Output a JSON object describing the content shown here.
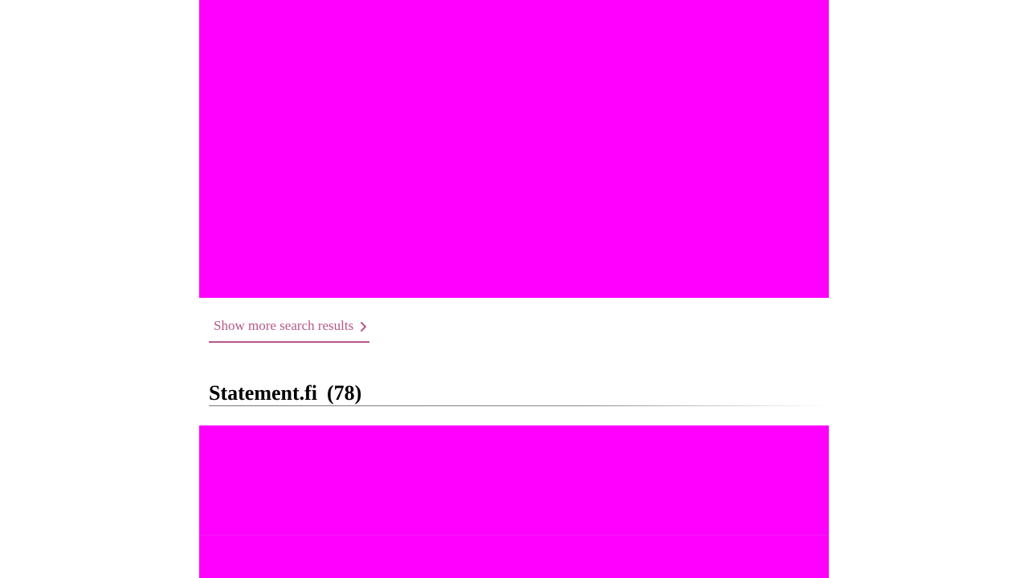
{
  "results": {
    "show_more_label": "Show more search results",
    "show_more_icon": "chevron-right-icon",
    "accent_color": "#b5588a"
  },
  "section": {
    "title": "Statement.fi",
    "count": "(78)"
  },
  "media": {
    "placeholder_color": "#ff00ff"
  }
}
